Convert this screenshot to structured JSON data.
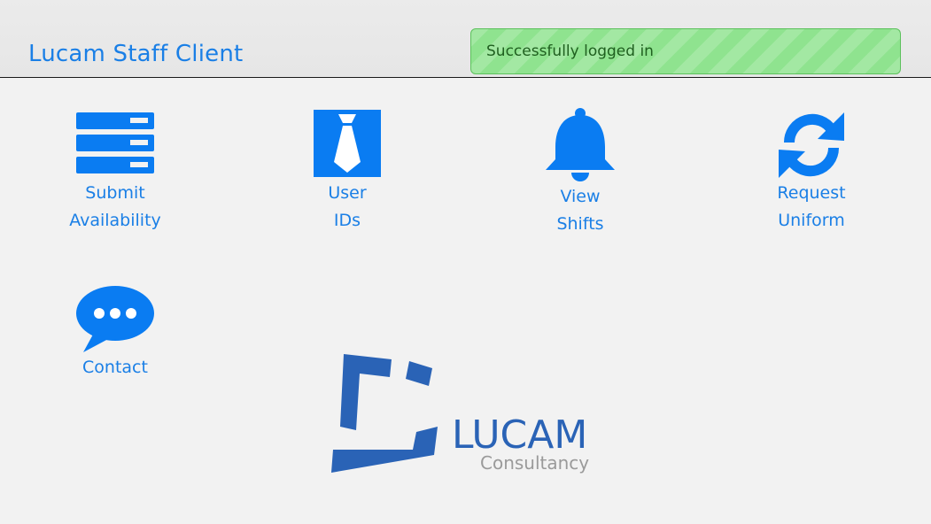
{
  "header": {
    "title": "Lucam Staff Client"
  },
  "toast": {
    "message": "Successfully logged in",
    "color": "#8fe38f"
  },
  "tiles": [
    {
      "icon": "list-icon",
      "line1": "Submit",
      "line2": "Availability"
    },
    {
      "icon": "tie-icon",
      "line1": "User",
      "line2": "IDs"
    },
    {
      "icon": "bell-icon",
      "line1": "View",
      "line2": "Shifts"
    },
    {
      "icon": "refresh-icon",
      "line1": "Request",
      "line2": "Uniform"
    },
    {
      "icon": "chat-icon",
      "line1": "Contact",
      "line2": ""
    }
  ],
  "logo": {
    "name": "LUCAM",
    "tagline": "Consultancy"
  },
  "colors": {
    "accent": "#1a7fe6",
    "icon_blue": "#0a7cf2",
    "logo_blue": "#2a63b6"
  }
}
